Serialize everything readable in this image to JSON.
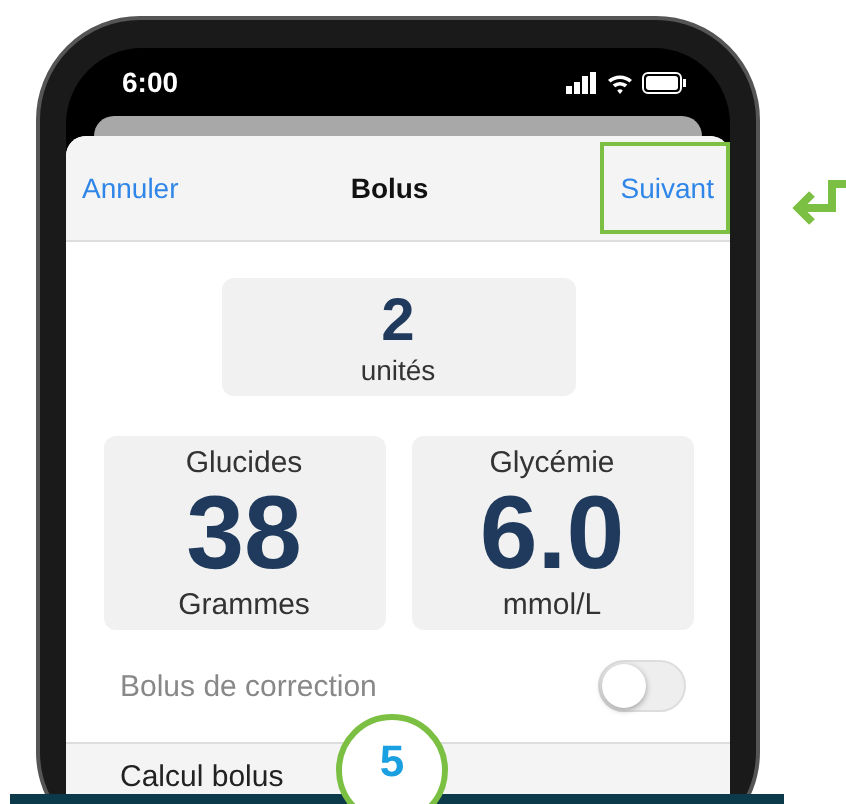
{
  "status_bar": {
    "time": "6:00"
  },
  "nav": {
    "cancel": "Annuler",
    "title": "Bolus",
    "next": "Suivant",
    "next_highlighted": true
  },
  "units": {
    "value": "2",
    "label": "unités"
  },
  "readings": [
    {
      "label": "Glucides",
      "value": "38",
      "unit": "Grammes"
    },
    {
      "label": "Glycémie",
      "value": "6.0",
      "unit": "mmol/L"
    }
  ],
  "correction": {
    "label": "Bolus de correction",
    "on": false,
    "disabled": true
  },
  "calc_row": {
    "label": "Calcul bolus"
  },
  "step_badge": "5"
}
